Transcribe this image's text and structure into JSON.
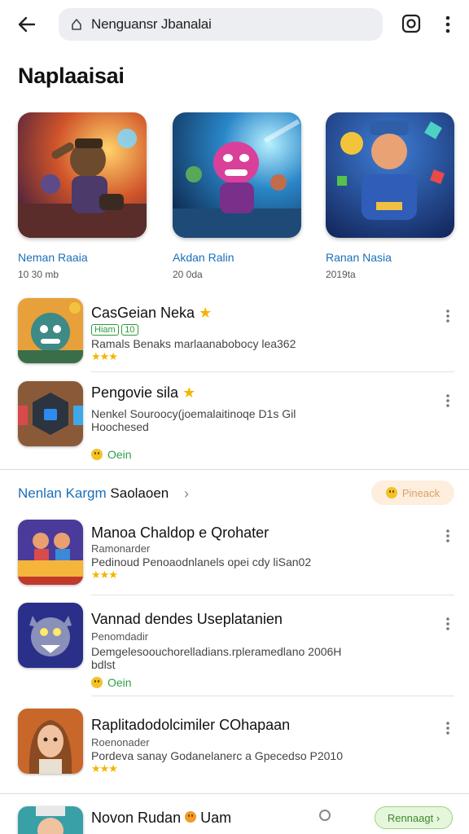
{
  "header": {
    "search_text": "Nenguansr Jbanalai",
    "title": "Naplaaisai"
  },
  "featured": [
    {
      "name": "Neman Raaia",
      "sub": "10 30 mb"
    },
    {
      "name": "Akdan Ralin",
      "sub": "20 0da"
    },
    {
      "name": "Ranan Nasia",
      "sub": "2019ta"
    }
  ],
  "list_top": [
    {
      "title": "CasGeian Neka",
      "badge_left": "Hiam",
      "badge": "10",
      "desc": "Ramals Benaks marlaanabobocy lea362",
      "stars": "★★★"
    },
    {
      "title": "Pengovie sila",
      "desc1": "Nenkel Souroocy(joemalaitinoqe D1s Gil",
      "desc2": "Hoochesed",
      "open": "Oein"
    }
  ],
  "section": {
    "title_blue": "Nenlan Kargm",
    "title_dark": "Saolaoen",
    "button": "Pineack"
  },
  "list_section": [
    {
      "title": "Manoa Chaldop e Qrohater",
      "sub": "Ramonarder",
      "desc": "Pedinoud Penoaodnlanels opei cdy liSan02",
      "stars": "★★★"
    },
    {
      "title": "Vannad dendes Useplatanien",
      "sub": "Penomdadir",
      "desc1": "Demgelesoouchorelladians.rpleramedlano 2006H",
      "desc2": "bdlst",
      "open": "Oein"
    },
    {
      "title": "Raplitadodolcimiler COhapaan",
      "sub": "Roenonader",
      "desc": "Pordeva sanay Godanelanerc a Gpecedso P2010",
      "stars": "★★★"
    }
  ],
  "bottom": {
    "title": "Novon Rudan",
    "title_tail": "Uam",
    "button": "Rennaagt"
  },
  "colors": {
    "accent_blue": "#1b6fb8",
    "open_green": "#2e9f47",
    "star_gold": "#f2b600"
  }
}
